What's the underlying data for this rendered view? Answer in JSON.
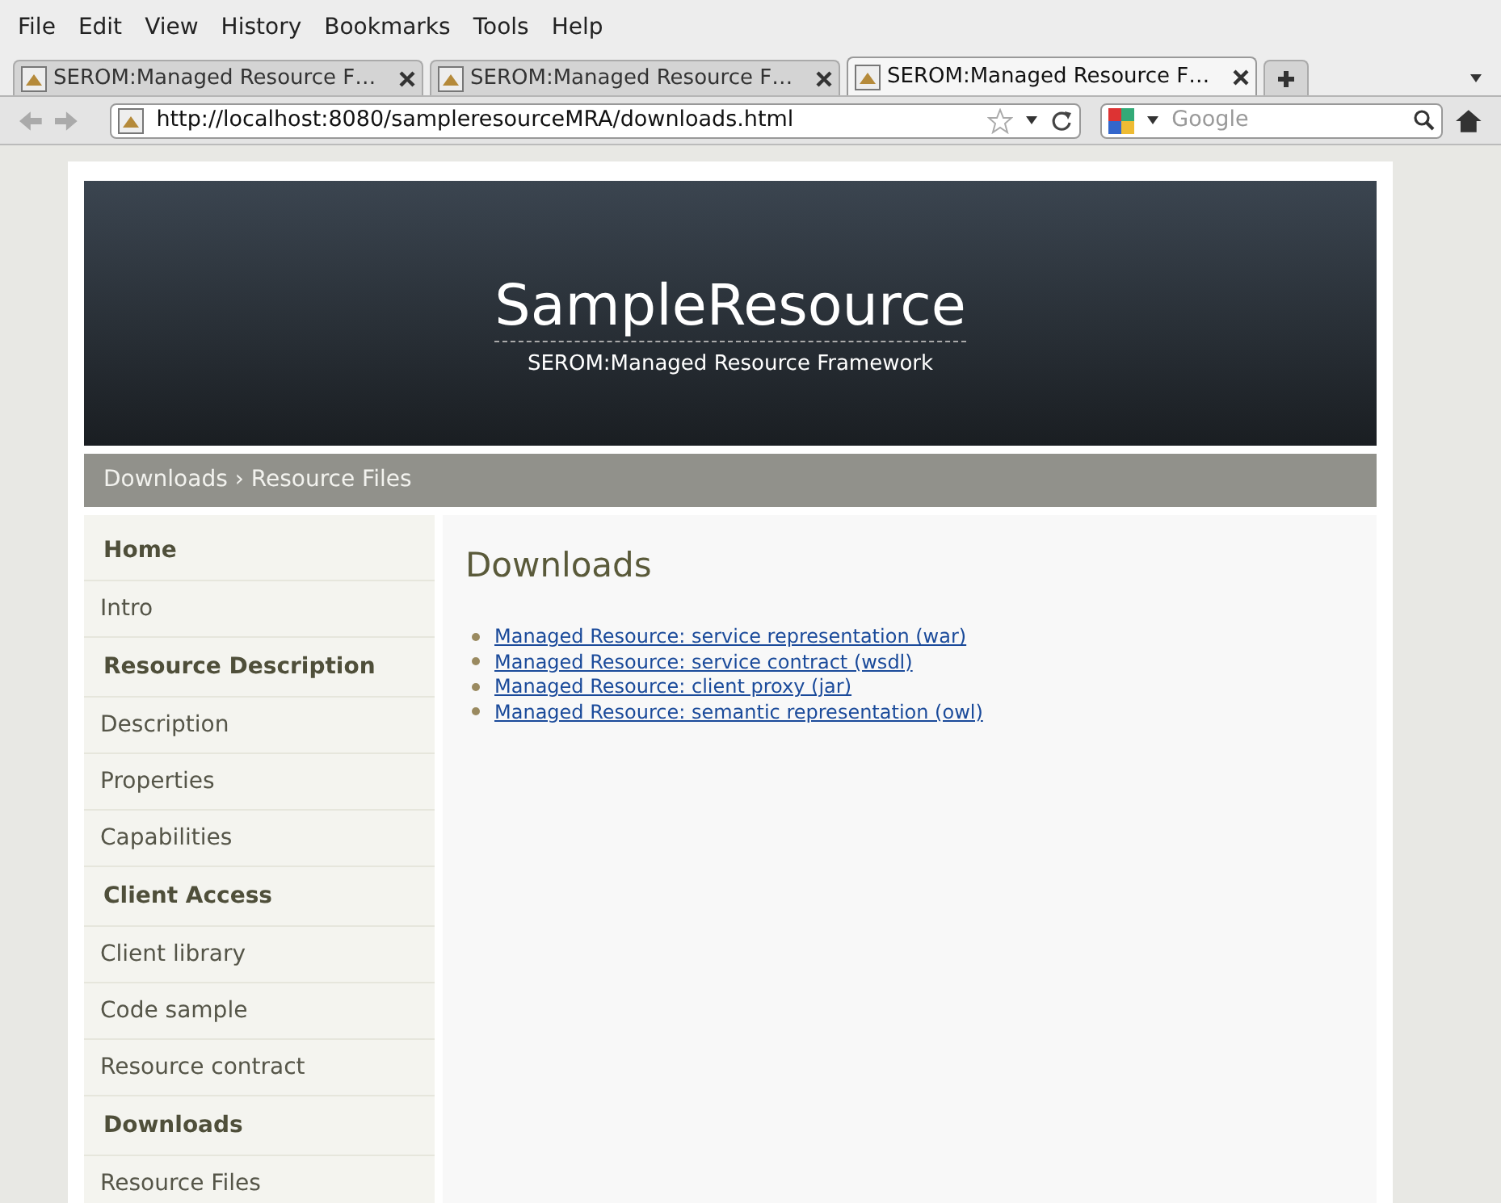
{
  "menu": [
    "File",
    "Edit",
    "View",
    "History",
    "Bookmarks",
    "Tools",
    "Help"
  ],
  "tabs": [
    {
      "label": "SEROM:Managed Resource F…",
      "selected": false
    },
    {
      "label": "SEROM:Managed Resource F…",
      "selected": false
    },
    {
      "label": "SEROM:Managed Resource F…",
      "selected": true
    }
  ],
  "address_bar": {
    "value": "http://localhost:8080/sampleresourceMRA/downloads.html"
  },
  "search": {
    "placeholder": "Google"
  },
  "header": {
    "title": "SampleResource",
    "subtitle": "SEROM:Managed Resource Framework"
  },
  "breadcrumb": "Downloads › Resource Files",
  "sidebar": {
    "items": [
      {
        "kind": "heading",
        "label": "Home"
      },
      {
        "kind": "link",
        "label": "Intro"
      },
      {
        "kind": "heading",
        "label": "Resource Description"
      },
      {
        "kind": "link",
        "label": "Description"
      },
      {
        "kind": "link",
        "label": "Properties"
      },
      {
        "kind": "link",
        "label": "Capabilities"
      },
      {
        "kind": "heading",
        "label": "Client Access"
      },
      {
        "kind": "link",
        "label": "Client library"
      },
      {
        "kind": "link",
        "label": "Code sample"
      },
      {
        "kind": "link",
        "label": "Resource contract"
      },
      {
        "kind": "heading",
        "label": "Downloads"
      },
      {
        "kind": "link",
        "label": "Resource Files"
      }
    ]
  },
  "content": {
    "title": "Downloads",
    "links": [
      "Managed Resource: service representation (war)",
      "Managed Resource: service contract (wsdl)",
      "Managed Resource: client proxy (jar)",
      "Managed Resource: semantic representation (owl)"
    ]
  }
}
